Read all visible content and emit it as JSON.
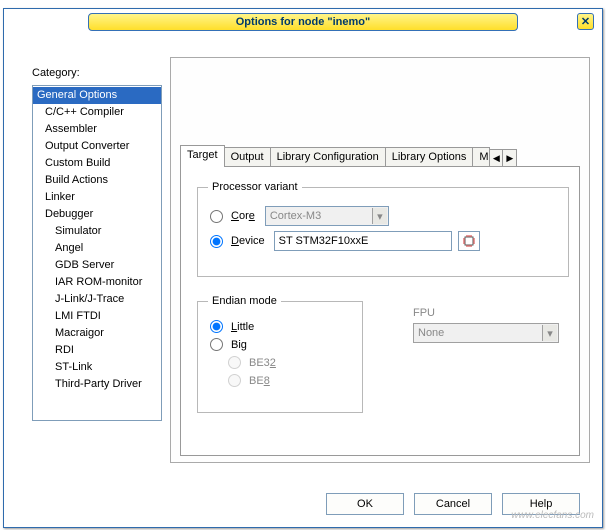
{
  "window": {
    "title": "Options for node \"inemo\""
  },
  "labels": {
    "category": "Category:",
    "fpu": "FPU",
    "buttons": {
      "ok": "OK",
      "cancel": "Cancel",
      "help": "Help"
    }
  },
  "category": {
    "items": [
      {
        "label": "General Options",
        "indent": false,
        "selected": true
      },
      {
        "label": "C/C++ Compiler",
        "indent": true,
        "selected": false
      },
      {
        "label": "Assembler",
        "indent": true,
        "selected": false
      },
      {
        "label": "Output Converter",
        "indent": true,
        "selected": false
      },
      {
        "label": "Custom Build",
        "indent": true,
        "selected": false
      },
      {
        "label": "Build Actions",
        "indent": true,
        "selected": false
      },
      {
        "label": "Linker",
        "indent": true,
        "selected": false
      },
      {
        "label": "Debugger",
        "indent": true,
        "selected": false
      },
      {
        "label": "Simulator",
        "indent": true,
        "indent2": true,
        "selected": false
      },
      {
        "label": "Angel",
        "indent": true,
        "indent2": true,
        "selected": false
      },
      {
        "label": "GDB Server",
        "indent": true,
        "indent2": true,
        "selected": false
      },
      {
        "label": "IAR ROM-monitor",
        "indent": true,
        "indent2": true,
        "selected": false
      },
      {
        "label": "J-Link/J-Trace",
        "indent": true,
        "indent2": true,
        "selected": false
      },
      {
        "label": "LMI FTDI",
        "indent": true,
        "indent2": true,
        "selected": false
      },
      {
        "label": "Macraigor",
        "indent": true,
        "indent2": true,
        "selected": false
      },
      {
        "label": "RDI",
        "indent": true,
        "indent2": true,
        "selected": false
      },
      {
        "label": "ST-Link",
        "indent": true,
        "indent2": true,
        "selected": false
      },
      {
        "label": "Third-Party Driver",
        "indent": true,
        "indent2": true,
        "selected": false
      }
    ]
  },
  "tabs": {
    "items": [
      "Target",
      "Output",
      "Library Configuration",
      "Library Options",
      "MI"
    ],
    "active_index": 0
  },
  "target": {
    "group_processor": "Processor variant",
    "radio_core": "Core",
    "radio_device": "Device",
    "core_value": "Cortex-M3",
    "device_value": "ST STM32F10xxE",
    "group_endian": "Endian mode",
    "radio_little": "Little",
    "radio_big": "Big",
    "radio_be32": "BE32",
    "radio_be8": "BE8",
    "processor_selected": "device",
    "endian_selected": "little"
  },
  "fpu": {
    "value": "None"
  },
  "watermark": "www.elecfans.com"
}
